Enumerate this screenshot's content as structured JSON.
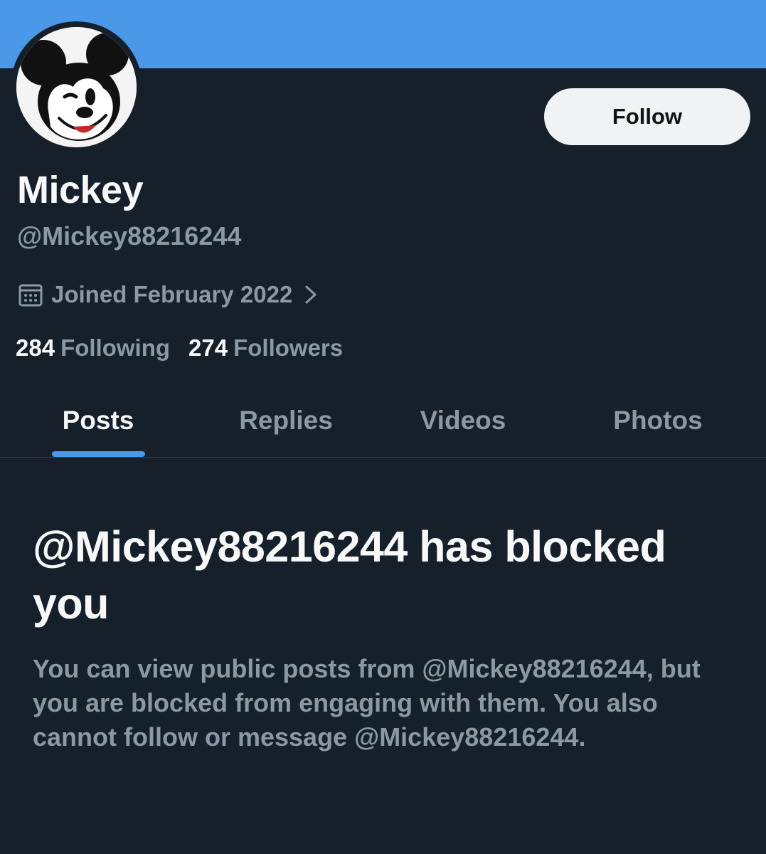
{
  "profile": {
    "display_name": "Mickey",
    "handle": "@Mickey88216244",
    "joined": "Joined February 2022",
    "following_count": "284",
    "following_label": "Following",
    "followers_count": "274",
    "followers_label": "Followers",
    "avatar_icon": "mickey-avatar-icon"
  },
  "actions": {
    "follow_label": "Follow"
  },
  "tabs": [
    {
      "label": "Posts",
      "active": true
    },
    {
      "label": "Replies",
      "active": false
    },
    {
      "label": "Videos",
      "active": false
    },
    {
      "label": "Photos",
      "active": false
    }
  ],
  "blocked": {
    "title": "@Mickey88216244 has blocked you",
    "description": "You can view public posts from @Mickey88216244, but you are blocked from engaging with them. You also cannot follow or message @Mickey88216244."
  },
  "colors": {
    "banner": "#4a99e9",
    "background": "#15202b",
    "accent": "#4a99e9",
    "primary_text": "#f7f9f9",
    "secondary_text": "#8b98a5"
  }
}
